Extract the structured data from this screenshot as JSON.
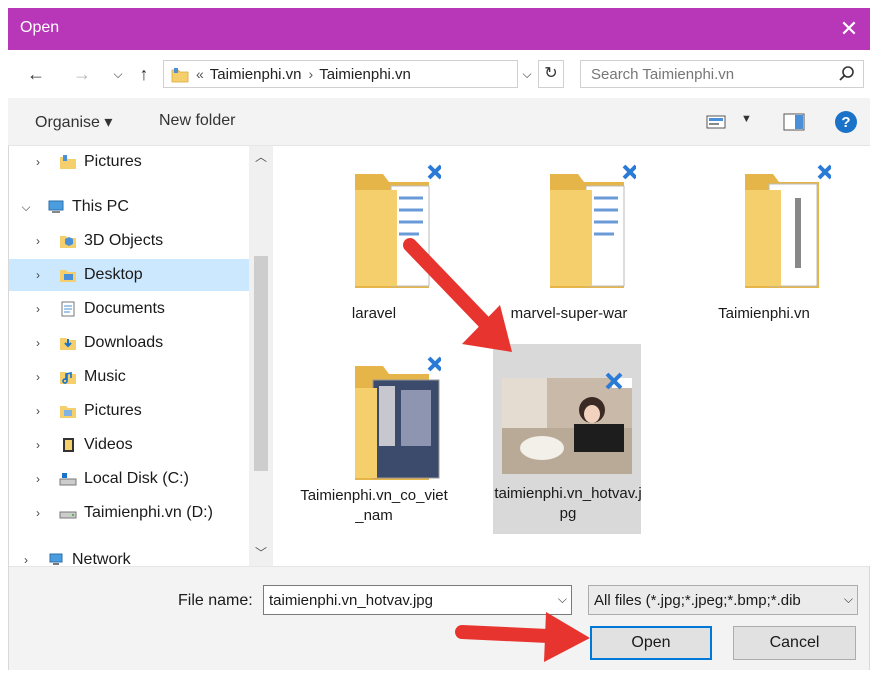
{
  "window": {
    "title": "Open",
    "close_glyph": "✕"
  },
  "address": {
    "prefix": "«",
    "crumbs": [
      "Taimienphi.vn",
      "Taimienphi.vn"
    ],
    "separator": "›"
  },
  "search": {
    "placeholder": "Search Taimienphi.vn"
  },
  "toolbar": {
    "organise_label": "Organise ▾",
    "new_folder_label": "New folder",
    "help_glyph": "?"
  },
  "sidebar": {
    "items": [
      {
        "label": "Pictures",
        "icon": "pictures-folder-icon",
        "expanded": false,
        "selected": false
      },
      {
        "label": "This PC",
        "icon": "computer-icon",
        "expanded": true,
        "selected": false
      },
      {
        "label": "3D Objects",
        "icon": "3d-objects-icon",
        "expanded": false,
        "selected": false
      },
      {
        "label": "Desktop",
        "icon": "desktop-folder-icon",
        "expanded": false,
        "selected": true
      },
      {
        "label": "Documents",
        "icon": "documents-folder-icon",
        "expanded": false,
        "selected": false
      },
      {
        "label": "Downloads",
        "icon": "downloads-folder-icon",
        "expanded": false,
        "selected": false
      },
      {
        "label": "Music",
        "icon": "music-folder-icon",
        "expanded": false,
        "selected": false
      },
      {
        "label": "Pictures",
        "icon": "pictures-folder-icon",
        "expanded": false,
        "selected": false
      },
      {
        "label": "Videos",
        "icon": "videos-folder-icon",
        "expanded": false,
        "selected": false
      },
      {
        "label": "Local Disk (C:)",
        "icon": "local-disk-icon",
        "expanded": false,
        "selected": false
      },
      {
        "label": "Taimienphi.vn (D:)",
        "icon": "drive-icon",
        "expanded": false,
        "selected": false
      },
      {
        "label": "Network",
        "icon": "network-icon",
        "expanded": false,
        "selected": false
      }
    ]
  },
  "files": [
    {
      "name": "laravel",
      "type": "folder",
      "selected": false
    },
    {
      "name": "marvel-super-war",
      "type": "folder",
      "selected": false
    },
    {
      "name": "Taimienphi.vn",
      "type": "folder-zip",
      "selected": false
    },
    {
      "name": "Taimienphi.vn_co_viet_nam",
      "type": "folder-photos",
      "selected": false
    },
    {
      "name": "taimienphi.vn_hotvav.jpg",
      "type": "image",
      "selected": true
    }
  ],
  "footer": {
    "file_name_label": "File name:",
    "file_name_value": "taimienphi.vn_hotvav.jpg",
    "filter_value": "All files (*.jpg;*.jpeg;*.bmp;*.dib",
    "open_label": "Open",
    "cancel_label": "Cancel"
  },
  "colors": {
    "title_bar": "#b836b8",
    "selection": "#cce8ff",
    "annotation_arrow": "#e8342e",
    "folder": "#f5cf6c"
  }
}
